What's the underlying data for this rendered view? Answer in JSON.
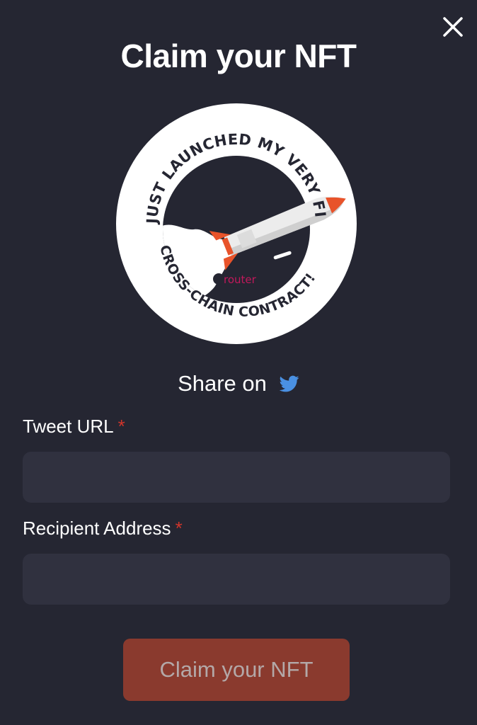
{
  "modal": {
    "title": "Claim your NFT"
  },
  "badge": {
    "top_text": "JUST LAUNCHED MY VERY FIRST",
    "bottom_text": "CROSS-CHAIN CONTRACT!",
    "brand": "router"
  },
  "share": {
    "label": "Share on",
    "icon": "twitter-icon"
  },
  "form": {
    "tweet_url": {
      "label": "Tweet URL",
      "required_mark": "*",
      "value": "",
      "placeholder": ""
    },
    "recipient_address": {
      "label": "Recipient Address",
      "required_mark": "*",
      "value": "",
      "placeholder": ""
    },
    "submit_label": "Claim your NFT"
  },
  "colors": {
    "background": "#252632",
    "input_bg": "#30313f",
    "required": "#d0352b",
    "button_bg": "#8a3a2e",
    "twitter": "#4a90e2",
    "rocket_orange": "#e8532a",
    "router_pink": "#c2185b"
  }
}
